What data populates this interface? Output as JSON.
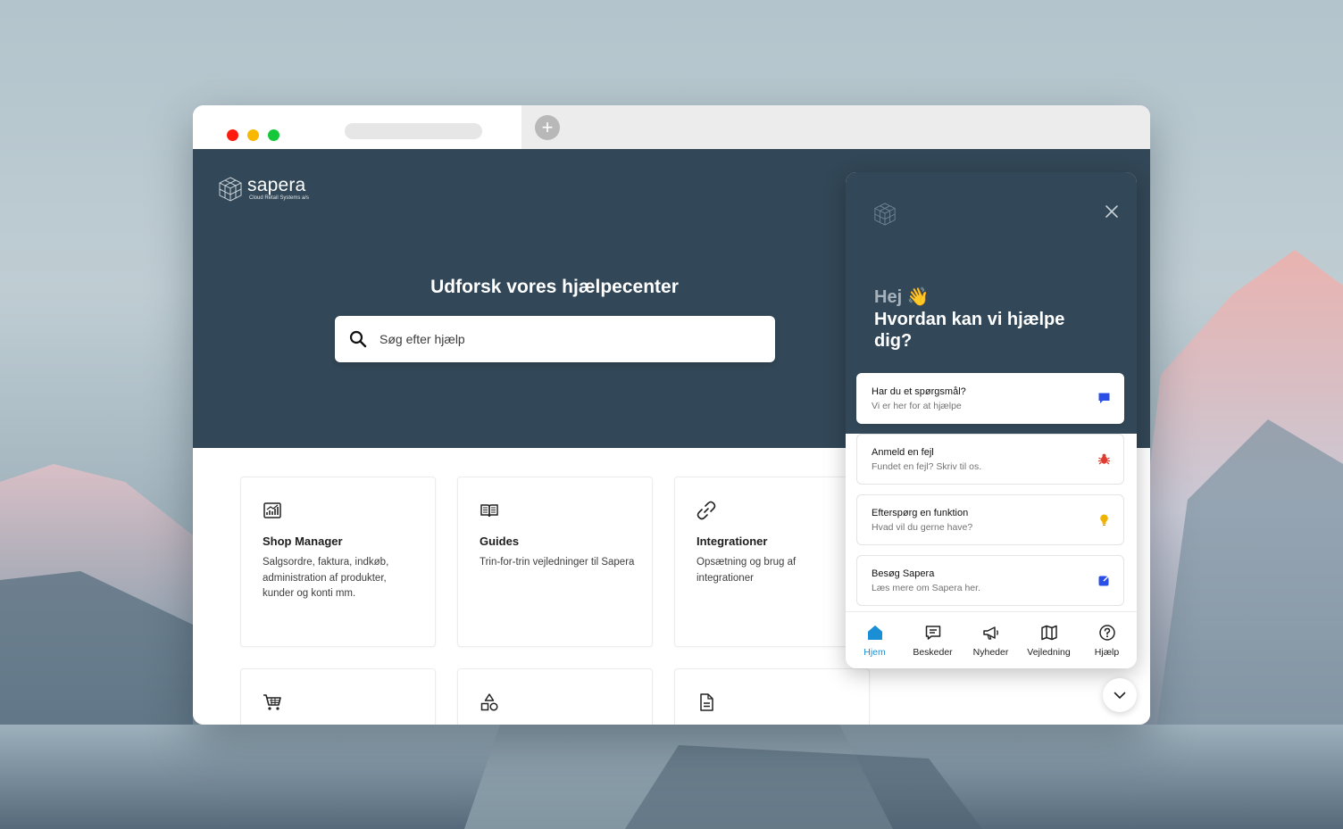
{
  "browser": {
    "new_tab_symbol": "+"
  },
  "brand": {
    "name": "sapera",
    "tagline": "Cloud Retail Systems a/s"
  },
  "hero": {
    "title": "Udforsk vores hjælpecenter",
    "search_placeholder": "Søg efter hjælp"
  },
  "cards": [
    {
      "icon": "chart-report-icon",
      "title": "Shop Manager",
      "description": "Salgsordre, faktura, indkøb, administration af produkter, kunder og konti mm."
    },
    {
      "icon": "book-icon",
      "title": "Guides",
      "description": "Trin-for-trin vejledninger til Sapera"
    },
    {
      "icon": "link-icon",
      "title": "Integrationer",
      "description": "Opsætning og brug af integrationer"
    },
    {
      "icon": "cart-icon",
      "title": "",
      "description": ""
    },
    {
      "icon": "shapes-icon",
      "title": "",
      "description": ""
    },
    {
      "icon": "document-icon",
      "title": "",
      "description": ""
    }
  ],
  "chat_panel": {
    "greeting_line1": "Hej 👋",
    "greeting_line2": "Hvordan kan vi hjælpe dig?",
    "actions": [
      {
        "title": "Har du et spørgsmål?",
        "subtitle": "Vi er her for at hjælpe",
        "icon": "chat-bubble-icon",
        "icon_color": "#2b4fe6"
      },
      {
        "title": "Anmeld en fejl",
        "subtitle": "Fundet en fejl? Skriv til os.",
        "icon": "bug-icon",
        "icon_color": "#e03b2f"
      },
      {
        "title": "Efterspørg en funktion",
        "subtitle": "Hvad vil du gerne have?",
        "icon": "lightbulb-icon",
        "icon_color": "#f0b400"
      },
      {
        "title": "Besøg Sapera",
        "subtitle": "Læs mere om Sapera her.",
        "icon": "external-link-icon",
        "icon_color": "#2b4fe6"
      }
    ],
    "nav": [
      {
        "label": "Hjem",
        "icon": "home-icon",
        "active": true
      },
      {
        "label": "Beskeder",
        "icon": "messages-icon",
        "active": false
      },
      {
        "label": "Nyheder",
        "icon": "megaphone-icon",
        "active": false
      },
      {
        "label": "Vejledning",
        "icon": "map-icon",
        "active": false
      },
      {
        "label": "Hjælp",
        "icon": "help-icon",
        "active": false
      }
    ]
  },
  "colors": {
    "hero_bg": "#324757",
    "accent": "#1a8fd6"
  }
}
